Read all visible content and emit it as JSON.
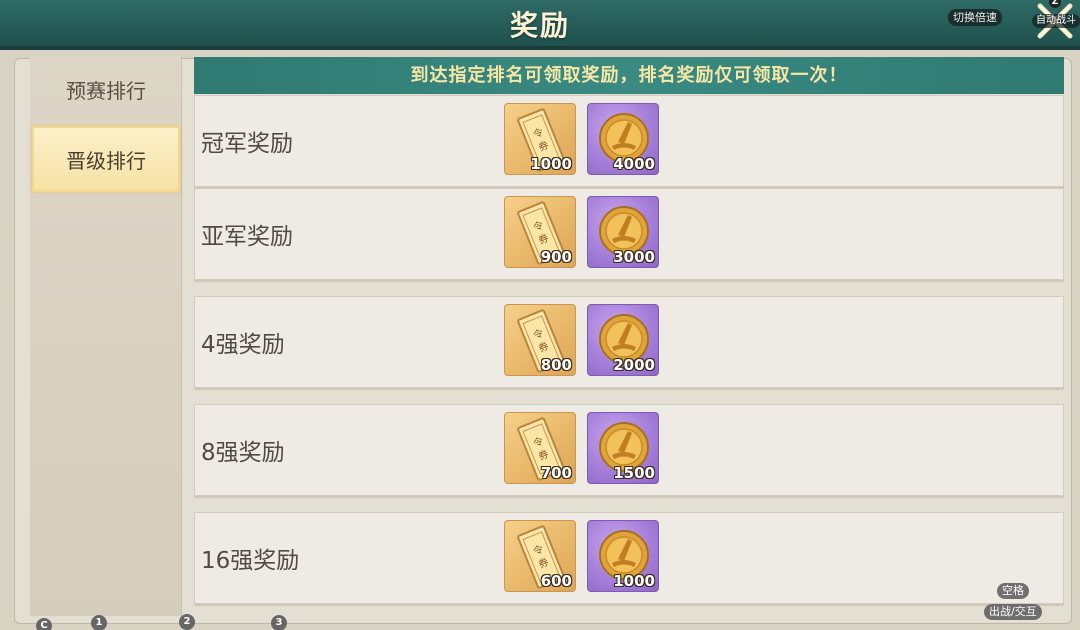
{
  "header": {
    "title": "奖励",
    "speed_button": "切换倍速",
    "auto_battle_key": "Z",
    "auto_battle_label": "自动战斗"
  },
  "sidebar": {
    "tabs": [
      {
        "label": "预赛排行",
        "active": false
      },
      {
        "label": "晋级排行",
        "active": true
      }
    ]
  },
  "notice": "到达指定排名可领取奖励，排名奖励仅可领取一次！",
  "rewards": [
    {
      "label": "冠军奖励",
      "ticket_qty": "1000",
      "coin_qty": "4000"
    },
    {
      "label": "亚军奖励",
      "ticket_qty": "900",
      "coin_qty": "3000"
    },
    {
      "label": "4强奖励",
      "ticket_qty": "800",
      "coin_qty": "2000"
    },
    {
      "label": "8强奖励",
      "ticket_qty": "700",
      "coin_qty": "1500"
    },
    {
      "label": "16强奖励",
      "ticket_qty": "600",
      "coin_qty": "1000"
    }
  ],
  "icons": {
    "ticket": "ticket-icon",
    "coin": "gold-coin-icon"
  },
  "overlays": {
    "key_c": "C",
    "key_1": "1",
    "key_2": "2",
    "key_3": "3",
    "space_label": "空格",
    "sortie_label": "出战/交互"
  },
  "colors": {
    "header": "#2f6b66",
    "notice_bg": "#3a8a82",
    "notice_text": "#f6e7a6",
    "active_tab": "#f6e2a4",
    "coin_bg": "#a57fd8",
    "ticket_bg": "#e9b86a"
  }
}
